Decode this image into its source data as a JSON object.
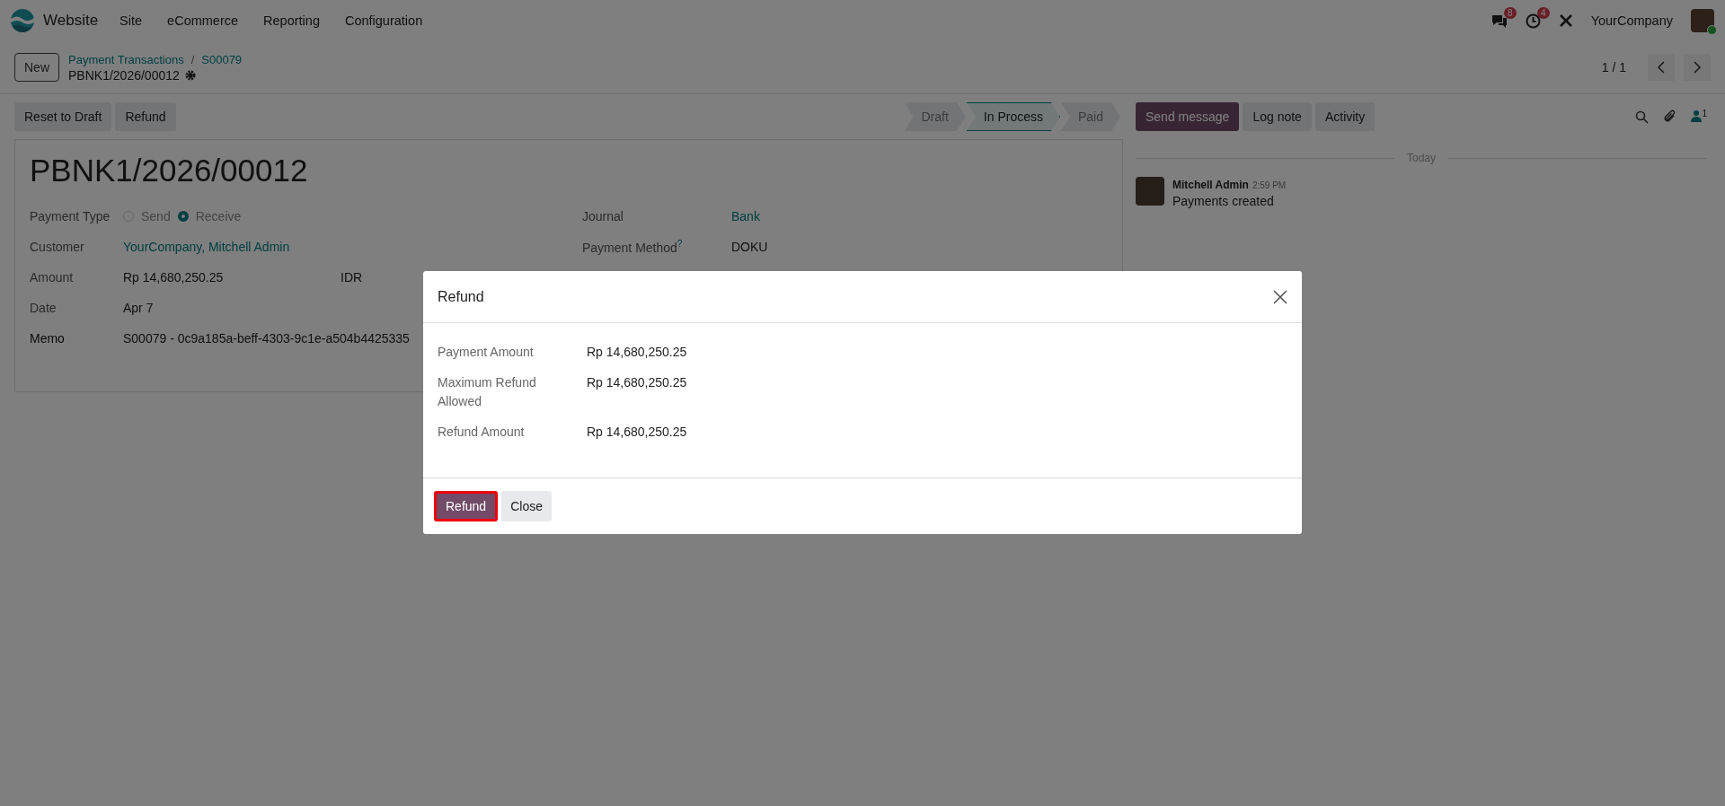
{
  "navbar": {
    "app_name": "Website",
    "menu": [
      "Site",
      "eCommerce",
      "Reporting",
      "Configuration"
    ],
    "messages_badge": "8",
    "activities_badge": "4",
    "company": "YourCompany"
  },
  "control_panel": {
    "new_button": "New",
    "breadcrumbs": [
      "Payment Transactions",
      "S00079"
    ],
    "breadcrumb_separator": "/",
    "record_name": "PBNK1/2026/00012",
    "pager": "1 / 1"
  },
  "actions": [
    "Reset to Draft",
    "Refund"
  ],
  "statusbar": [
    {
      "label": "Draft",
      "selected": false
    },
    {
      "label": "In Process",
      "selected": true
    },
    {
      "label": "Paid",
      "selected": false
    }
  ],
  "form": {
    "title": "PBNK1/2026/00012",
    "payment_type": {
      "label": "Payment Type",
      "options": [
        {
          "label": "Send",
          "selected": false
        },
        {
          "label": "Receive",
          "selected": true
        }
      ]
    },
    "left_fields": [
      {
        "label": "Customer",
        "value": "YourCompany, Mitchell Admin",
        "kind": "link",
        "required": false
      },
      {
        "label": "Amount",
        "value": "Rp 14,680,250.25",
        "currency": "IDR",
        "kind": "amount",
        "required": false
      },
      {
        "label": "Date",
        "value": "Apr 7",
        "kind": "text",
        "required": false
      },
      {
        "label": "Memo",
        "value": "S00079 - 0c9a185a-beff-4303-9c1e-a504b4425335",
        "kind": "text",
        "required": true
      }
    ],
    "right_fields": [
      {
        "label": "Journal",
        "value": "Bank",
        "kind": "link"
      },
      {
        "label": "Payment Method",
        "value": "DOKU",
        "kind": "text",
        "help_mark": "?"
      }
    ]
  },
  "chatter": {
    "buttons": [
      {
        "label": "Send message",
        "kind": "primary"
      },
      {
        "label": "Log note",
        "kind": "secondary"
      },
      {
        "label": "Activity",
        "kind": "secondary"
      }
    ],
    "followers_count": "1",
    "date_separator": "Today",
    "messages": [
      {
        "author": "Mitchell Admin",
        "time": "2:59 PM",
        "body": "Payments created"
      }
    ]
  },
  "dialog": {
    "title": "Refund",
    "rows": [
      {
        "label": "Payment Amount",
        "value": "Rp 14,680,250.25"
      },
      {
        "label": "Maximum Refund Allowed",
        "value": "Rp 14,680,250.25"
      },
      {
        "label": "Refund Amount",
        "value": "Rp 14,680,250.25"
      }
    ],
    "buttons": [
      {
        "label": "Refund",
        "kind": "primary",
        "highlighted": true
      },
      {
        "label": "Close",
        "kind": "secondary",
        "highlighted": false
      }
    ]
  }
}
